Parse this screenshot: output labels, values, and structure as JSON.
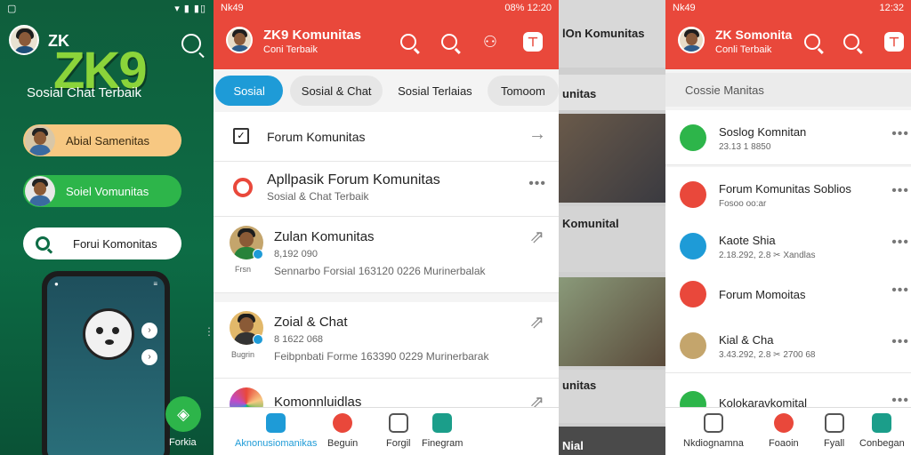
{
  "panel1": {
    "status_time": "",
    "brand_small": "ZK",
    "brand_big": "ZK9",
    "tagline": "Sosial Chat Terbaik",
    "pills": [
      {
        "label": "Abial Samenitas"
      },
      {
        "label": "Soiel Vomunitas"
      },
      {
        "label": "Forui Komonitas"
      }
    ],
    "fab_label": "Forkia"
  },
  "panel2": {
    "status_time": "Nk49",
    "status_right": "08% 12:20",
    "title": "ZK9 Komunitas",
    "subtitle": "Coni Terbaik",
    "tabs": [
      "Sosial",
      "Sosial & Chat",
      "Sosial Terlaias",
      "Tomoom"
    ],
    "rows": [
      {
        "label": "Forum Komunitas"
      },
      {
        "label": "Apllpasik Forum Komunitas",
        "sub": "Sosial & Chat Terbaik"
      },
      {
        "label": "Zulan Komunitas",
        "meta": "8,192 090",
        "detail": "Sennarbo Forsial 163120 0226 Murinerbalak",
        "avatar_label": "Frsn"
      },
      {
        "label": "Zoial & Chat",
        "meta": "8 1622 068",
        "detail": "Feibpnbati Forme 163390 0229 Murinerbarak",
        "avatar_label": "Bugrin"
      },
      {
        "label": "Komonnluidlas"
      }
    ],
    "nav": [
      {
        "label": "Aknonusiomanikas",
        "color": "#1e9bd7"
      },
      {
        "label": "Beguin",
        "color": "#e9483b"
      },
      {
        "label": "Forgil",
        "color": "#555555"
      },
      {
        "label": "Finegram",
        "color": "#1b9e8a"
      }
    ]
  },
  "panel3": {
    "labels": [
      "lOn Komunitas",
      "unitas",
      "Komunital",
      "unitas",
      "Nial"
    ]
  },
  "panel4": {
    "status_time": "Nk49",
    "status_right": "12:32",
    "title": "ZK Somonita",
    "subtitle": "Conli Terbaik",
    "search_placeholder": "Cossie Manitas",
    "rows": [
      {
        "label": "Soslog Komnitan",
        "sub": "23.13 1 8850",
        "color": "#2db54a"
      },
      {
        "label": "Forum Komunitas Soblios",
        "sub": "Fosoo oo:ar",
        "color": "#e9483b"
      },
      {
        "label": "Kaote Shia",
        "sub": "2.18.292, 2.8 ✂ Xandlas",
        "color": "#1e9bd7"
      },
      {
        "label": "Forum Momoitas",
        "sub": "",
        "color": "#e9483b"
      },
      {
        "label": "Kial & Cha",
        "sub": "3.43.292, 2.8 ✂ 2700 68",
        "color": "#c4a56c"
      },
      {
        "label": "Kolokaravkomital",
        "sub": "",
        "color": "#2db54a"
      }
    ],
    "nav": [
      {
        "label": "Nkdiognamna",
        "color": "#555555"
      },
      {
        "label": "Foaoin",
        "color": "#e9483b"
      },
      {
        "label": "Fyall",
        "color": "#555555"
      },
      {
        "label": "Conbegan",
        "color": "#1b9e8a"
      }
    ]
  }
}
